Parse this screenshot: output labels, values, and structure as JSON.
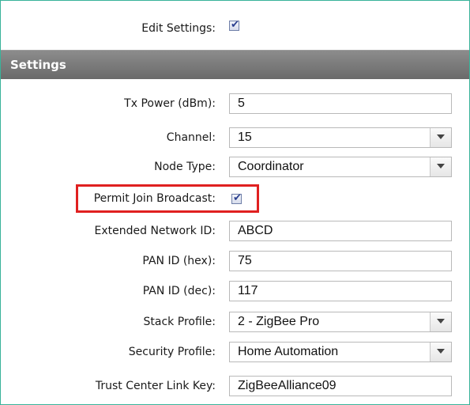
{
  "edit_settings": {
    "label": "Edit Settings:",
    "checked": true
  },
  "section": {
    "title": "Settings"
  },
  "fields": {
    "tx_power": {
      "label": "Tx Power (dBm):",
      "value": "5"
    },
    "channel": {
      "label": "Channel:",
      "value": "15"
    },
    "node_type": {
      "label": "Node Type:",
      "value": "Coordinator"
    },
    "permit_join": {
      "label": "Permit Join Broadcast:",
      "checked": true
    },
    "extended_network_id": {
      "label": "Extended Network ID:",
      "value": "ABCD"
    },
    "pan_id_hex": {
      "label": "PAN ID (hex):",
      "value": "75"
    },
    "pan_id_dec": {
      "label": "PAN ID (dec):",
      "value": "117"
    },
    "stack_profile": {
      "label": "Stack Profile:",
      "value": "2 - ZigBee Pro"
    },
    "security_profile": {
      "label": "Security Profile:",
      "value": "Home Automation"
    },
    "trust_center_link_key": {
      "label": "Trust Center Link Key:",
      "value": "ZigBeeAlliance09"
    }
  },
  "colors": {
    "frame_border": "#39b39a",
    "header_bg": "#7a7a7a",
    "highlight": "#e02020"
  },
  "icons": {
    "checkbox_tick": "checkmark-icon",
    "dropdown": "chevron-down-icon"
  }
}
